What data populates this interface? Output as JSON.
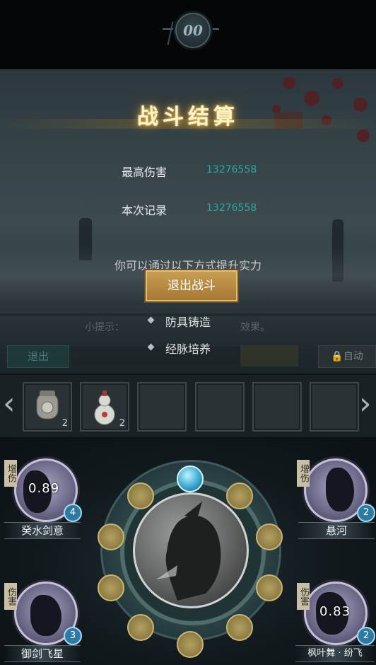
{
  "hud": {
    "timer": "00"
  },
  "result": {
    "title": "战斗结算",
    "stats": [
      {
        "label": "最高伤害",
        "value": "13276558"
      },
      {
        "label": "本次记录",
        "value": "13276558"
      }
    ],
    "hint": "你可以通过以下方式提升实力",
    "improve": [
      "防具铸造",
      "经脉培养"
    ],
    "exit_button": "退出战斗"
  },
  "battle_hud": {
    "tip_prefix": "小提示：",
    "tip_suffix": "效果。",
    "exit_label": "退出",
    "auto_label": "自动"
  },
  "items": [
    {
      "icon": "pouch-icon",
      "count": "2"
    },
    {
      "icon": "gourd-icon",
      "count": "2"
    },
    {
      "icon": "",
      "count": ""
    },
    {
      "icon": "",
      "count": ""
    },
    {
      "icon": "",
      "count": ""
    },
    {
      "icon": "",
      "count": ""
    }
  ],
  "skills": {
    "top_left": {
      "tag": "增伤",
      "cooldown": "0.89",
      "level": "4",
      "name": "癸水剑意"
    },
    "top_right": {
      "tag": "增伤",
      "cooldown": "",
      "level": "2",
      "name": "悬河"
    },
    "bottom_left": {
      "tag": "伤害",
      "cooldown": "",
      "level": "3",
      "name": "御剑飞星"
    },
    "bottom_right": {
      "tag": "伤害",
      "cooldown": "0.83",
      "level": "2",
      "name": "枫叶舞 · 纷飞"
    }
  },
  "colors": {
    "accent_gold": "#c79d53",
    "stat_value_teal": "#2aa89a",
    "title_glow": "#e6b54d"
  }
}
